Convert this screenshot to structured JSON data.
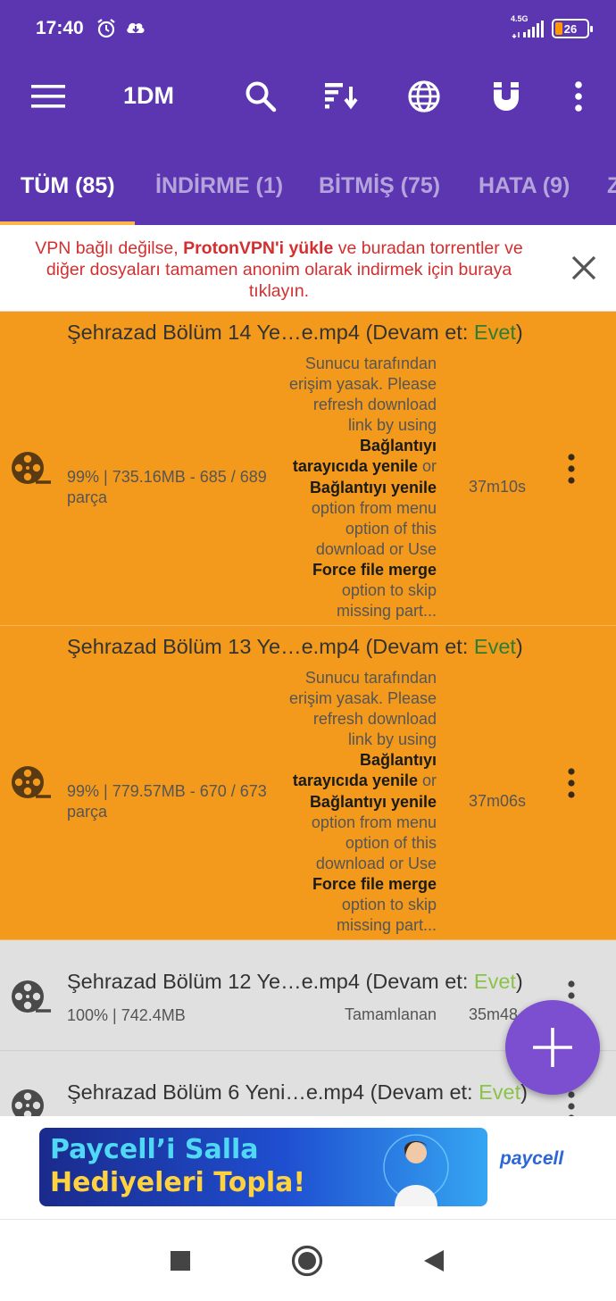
{
  "status_bar": {
    "time": "17:40",
    "network": "4.5G",
    "battery": "26"
  },
  "toolbar": {
    "title": "1DM"
  },
  "tabs": [
    {
      "label": "TÜM (85)"
    },
    {
      "label": "İNDİRME (1)"
    },
    {
      "label": "BİTMİŞ (75)"
    },
    {
      "label": "HATA (9)"
    },
    {
      "label": "Z"
    }
  ],
  "vpn_banner": {
    "text_1": "VPN bağlı değilse, ",
    "text_link": "ProtonVPN'i yükle",
    "text_2": " ve buradan torrentler ve diğer dosyaları tamamen anonim olarak indirmek için buraya tıklayın."
  },
  "err_message": {
    "p1": "Sunucu tarafından erişim yasak. Please refresh download link by using ",
    "b1": "Bağlantıyı tarayıcıda yenile",
    "p2": " or ",
    "b2": "Bağlantıyı yenile",
    "p3": " option from menu option of this download or Use ",
    "b3": "Force file merge",
    "p4": " option to skip missing part..."
  },
  "downloads": [
    {
      "name_prefix": "Şehrazad Bölüm 14 Ye…e.mp4 (Devam et: ",
      "resume": "Evet",
      "name_suffix": ")",
      "progress": "99% | 735.16MB - 685 / 689 parça",
      "time": "37m10s"
    },
    {
      "name_prefix": "Şehrazad Bölüm 13 Ye…e.mp4 (Devam et: ",
      "resume": "Evet",
      "name_suffix": ")",
      "progress": "99% | 779.57MB - 670 / 673 parça",
      "time": "37m06s"
    },
    {
      "name_prefix": "Şehrazad Bölüm 12 Ye…e.mp4 (Devam et: ",
      "resume": "Evet",
      "name_suffix": ")",
      "progress": "100% | 742.4MB",
      "status": "Tamamlanan",
      "time": "35m48"
    },
    {
      "name_prefix": "Şehrazad Bölüm 6 Yeni…e.mp4 (Devam et: ",
      "resume": "Evet",
      "name_suffix": ")"
    }
  ],
  "ad": {
    "line1": "Paycell’i Salla",
    "line2": "Hediyeleri Topla!",
    "brand": "paycell"
  },
  "colors": {
    "primary": "#5c35b1",
    "error_item": "#f39a1d",
    "completed_item": "#e0e0e0",
    "fab": "#7b4fd0",
    "vpn_text": "#d32f2f"
  }
}
